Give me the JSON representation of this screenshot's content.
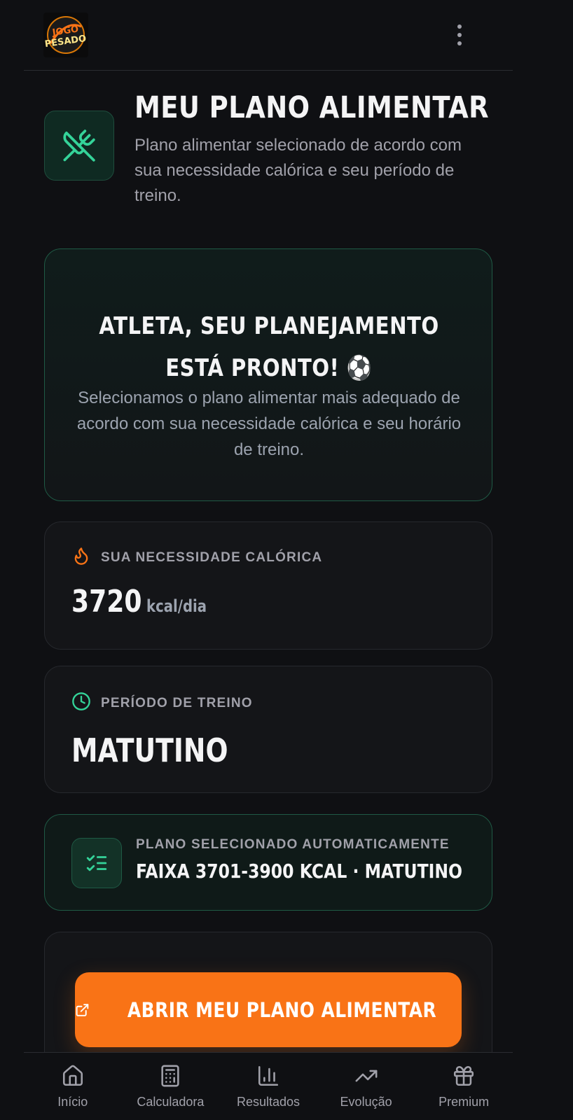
{
  "header": {
    "logo_text": [
      "JOGO",
      "PESADO"
    ],
    "menu_icon": "more-vertical-icon"
  },
  "page": {
    "title": "MEU PLANO ALIMENTAR",
    "subtitle": "Plano alimentar selecionado de acordo com sua necessidade calórica e seu período de treino.",
    "icon": "utensils-crossed-icon"
  },
  "hero": {
    "title_line1": "ATLETA, SEU PLANEJAMENTO",
    "title_line2": "ESTÁ PRONTO! ⚽",
    "body": "Selecionamos o plano alimentar mais adequado de acordo com sua necessidade calórica e seu horário de treino."
  },
  "calories": {
    "label": "SUA NECESSIDADE CALÓRICA",
    "value": "3720",
    "unit": "kcal/dia",
    "icon": "flame-icon"
  },
  "training": {
    "label": "PERÍODO DE TREINO",
    "value": "MATUTINO",
    "icon": "clock-icon"
  },
  "plan": {
    "label": "PLANO SELECIONADO AUTOMATICAMENTE",
    "value": "FAIXA 3701-3900 KCAL · MATUTINO",
    "icon": "list-checks-icon"
  },
  "cta": {
    "label": "ABRIR MEU PLANO ALIMENTAR",
    "icon": "external-link-icon"
  },
  "nav": [
    {
      "label": "Início",
      "icon": "home-icon"
    },
    {
      "label": "Calculadora",
      "icon": "calculator-icon"
    },
    {
      "label": "Resultados",
      "icon": "bar-chart-icon"
    },
    {
      "label": "Evolução",
      "icon": "trending-up-icon"
    },
    {
      "label": "Premium",
      "icon": "gift-icon"
    }
  ],
  "colors": {
    "background": "#0f1013",
    "accent_green": "#34d399",
    "accent_orange": "#f97316",
    "text_muted": "#a1a1aa"
  }
}
